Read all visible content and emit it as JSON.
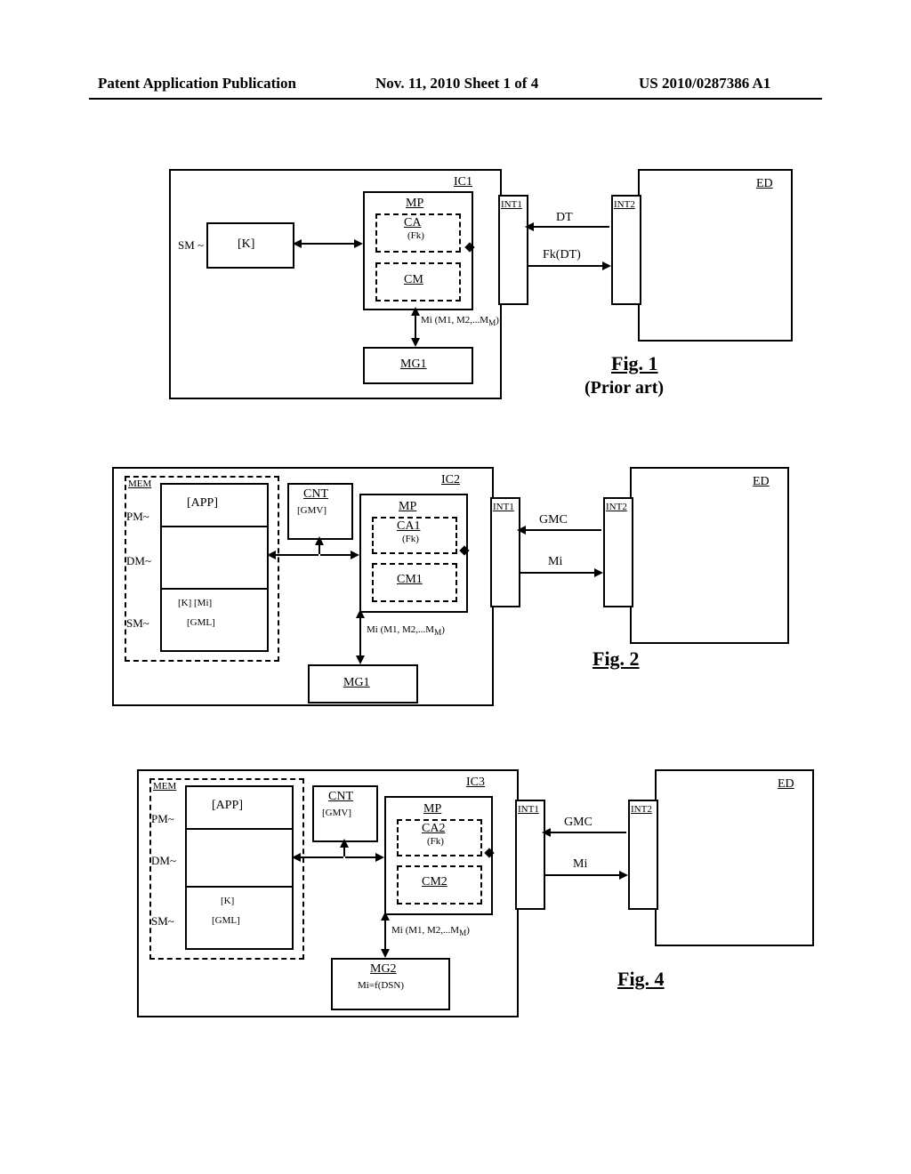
{
  "header": {
    "left": "Patent Application Publication",
    "mid": "Nov. 11, 2010  Sheet 1 of 4",
    "right": "US 2010/0287386 A1"
  },
  "common": {
    "IC1": "IC1",
    "IC2": "IC2",
    "IC3": "IC3",
    "MP": "MP",
    "CA": "CA",
    "CA1": "CA1",
    "CA2": "CA2",
    "Fk": "(Fk)",
    "CM": "CM",
    "CM1": "CM1",
    "CM2": "CM2",
    "SM": "SM",
    "K": "[K]",
    "Mi_list": "Mi (M1, M2,...M",
    "Mi_suffix": "M",
    "Mi_end": ")",
    "MG1": "MG1",
    "MG2": "MG2",
    "MG2_fn": "Mi=f(DSN)",
    "INT1": "INT1",
    "INT2": "INT2",
    "DT": "DT",
    "FkDT": "Fk(DT)",
    "GMC": "GMC",
    "Mi": "Mi",
    "ED": "ED",
    "MEM": "MEM",
    "PM": "PM",
    "DM": "DM",
    "APP": "[APP]",
    "CNT": "CNT",
    "GMV": "[GMV]",
    "K_Mi": "[K] [Mi]",
    "GML": "[GML]"
  },
  "figs": {
    "fig1": "Fig. 1",
    "prior": "(Prior art)",
    "fig2": "Fig. 2",
    "fig4": "Fig. 4"
  }
}
